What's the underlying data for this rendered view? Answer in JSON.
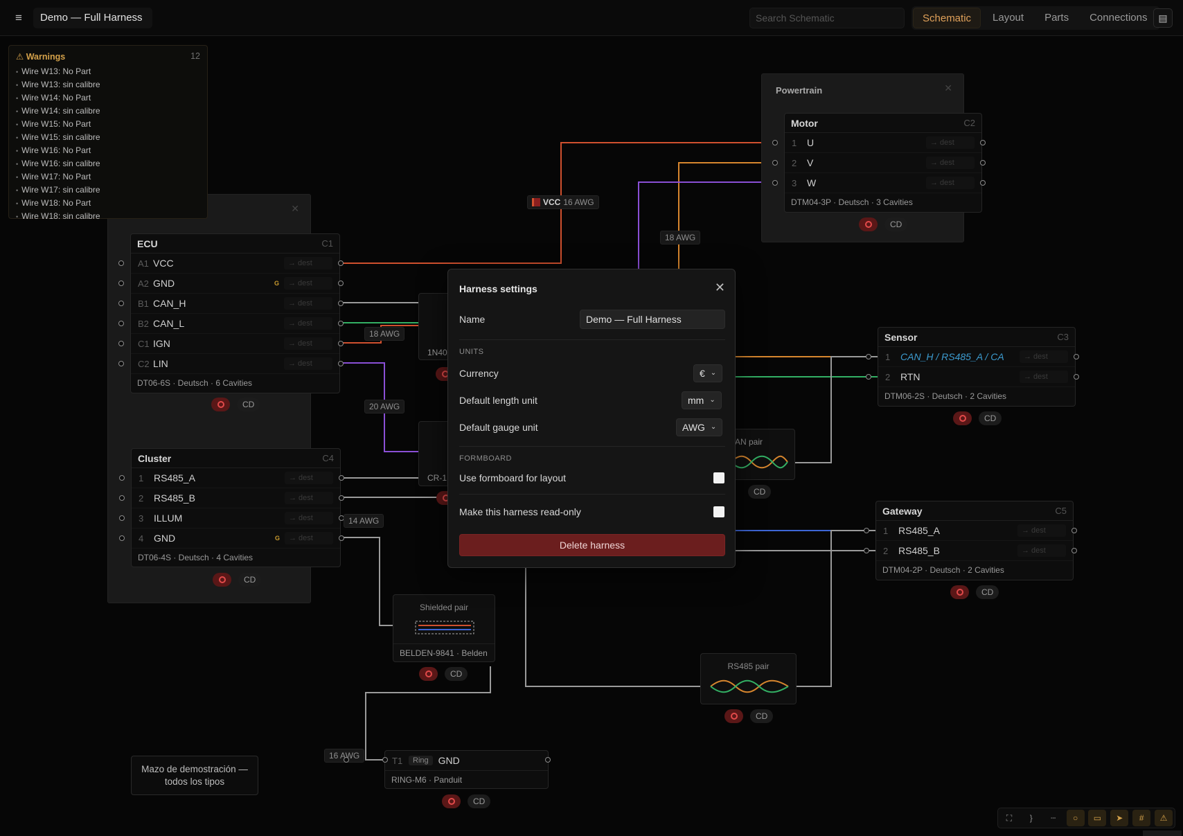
{
  "topbar": {
    "menu_icon": "≡",
    "harness_title": "Demo — Full Harness",
    "search_placeholder": "Search Schematic",
    "tabs": [
      {
        "label": "Schematic",
        "active": true
      },
      {
        "label": "Layout",
        "active": false
      },
      {
        "label": "Parts",
        "active": false
      },
      {
        "label": "Connections",
        "active": false
      }
    ]
  },
  "warnings": {
    "title": "Warnings",
    "count": "12",
    "items": [
      "Wire W13: No Part",
      "Wire W13: sin calibre",
      "Wire W14: No Part",
      "Wire W14: sin calibre",
      "Wire W15: No Part",
      "Wire W15: sin calibre",
      "Wire W16: No Part",
      "Wire W16: sin calibre",
      "Wire W17: No Part",
      "Wire W17: sin calibre",
      "Wire W18: No Part",
      "Wire W18: sin calibre"
    ]
  },
  "groups": {
    "powertrain": "Powertrain"
  },
  "connectors": {
    "ecu": {
      "name": "ECU",
      "code": "C1",
      "footer": "DT06-6S · Deutsch · 6 Cavities",
      "pins": [
        {
          "num": "A1",
          "label": "VCC",
          "ground": ""
        },
        {
          "num": "A2",
          "label": "GND",
          "ground": "G"
        },
        {
          "num": "B1",
          "label": "CAN_H",
          "ground": ""
        },
        {
          "num": "B2",
          "label": "CAN_L",
          "ground": ""
        },
        {
          "num": "C1",
          "label": "IGN",
          "ground": ""
        },
        {
          "num": "C2",
          "label": "LIN",
          "ground": ""
        }
      ]
    },
    "cluster": {
      "name": "Cluster",
      "code": "C4",
      "footer": "DT06-4S · Deutsch · 4 Cavities",
      "pins": [
        {
          "num": "1",
          "label": "RS485_A",
          "ground": ""
        },
        {
          "num": "2",
          "label": "RS485_B",
          "ground": ""
        },
        {
          "num": "3",
          "label": "ILLUM",
          "ground": ""
        },
        {
          "num": "4",
          "label": "GND",
          "ground": "G"
        }
      ]
    },
    "motor": {
      "name": "Motor",
      "code": "C2",
      "footer": "DTM04-3P · Deutsch · 3 Cavities",
      "pins": [
        {
          "num": "1",
          "label": "U",
          "ground": ""
        },
        {
          "num": "2",
          "label": "V",
          "ground": ""
        },
        {
          "num": "3",
          "label": "W",
          "ground": ""
        }
      ]
    },
    "sensor": {
      "name": "Sensor",
      "code": "C3",
      "footer": "DTM06-2S · Deutsch · 2 Cavities",
      "pins": [
        {
          "num": "1",
          "label": "CAN_H / RS485_A / CA ",
          "ground": ""
        },
        {
          "num": "2",
          "label": "RTN",
          "ground": ""
        }
      ]
    },
    "gateway": {
      "name": "Gateway",
      "code": "C5",
      "footer": "DTM04-2P · Deutsch · 2 Cavities",
      "pins": [
        {
          "num": "1",
          "label": "RS485_A",
          "ground": ""
        },
        {
          "num": "2",
          "label": "RS485_B",
          "ground": ""
        }
      ]
    },
    "ring": {
      "pin_num": "T1",
      "type": "Ring",
      "label": "GND",
      "footer": "RING-M6 · Panduit"
    }
  },
  "pin_dest": "→ dest",
  "badge_cd": "CD",
  "pairs": {
    "shielded": {
      "title": "Shielded pair",
      "footer": "BELDEN-9841 · Belden"
    },
    "rs485": {
      "title": "RS485 pair"
    },
    "can": {
      "title": "AN pair"
    }
  },
  "hidden_parts": {
    "diode": "1N40",
    "resistor": "CR-1"
  },
  "wire_labels": {
    "vcc_name": "VCC",
    "vcc_gauge": "16 AWG",
    "motor_gauge": "18 AWG",
    "ign_gauge": "18 AWG",
    "lin_gauge": "20 AWG",
    "gnd_gauge": "14 AWG",
    "ring_gauge": "16 AWG"
  },
  "modal": {
    "title": "Harness settings",
    "name_label": "Name",
    "name_value": "Demo — Full Harness",
    "units_section": "UNITS",
    "currency_label": "Currency",
    "currency_value": "€",
    "length_label": "Default length unit",
    "length_value": "mm",
    "gauge_label": "Default gauge unit",
    "gauge_value": "AWG",
    "formboard_section": "FORMBOARD",
    "formboard_label": "Use formboard for layout",
    "readonly_label": "Make this harness read-only",
    "delete_label": "Delete harness"
  },
  "note": {
    "text": "Mazo de demostración — todos los tipos"
  },
  "colors": {
    "accent": "#e0a15a",
    "danger": "#6b1e1e",
    "wire_red": "#d0502e",
    "wire_orange": "#d7862e",
    "wire_purple": "#8a4fd6",
    "wire_green": "#33b064",
    "wire_blue": "#3e66d6",
    "wire_grey": "#9a9a9a"
  }
}
